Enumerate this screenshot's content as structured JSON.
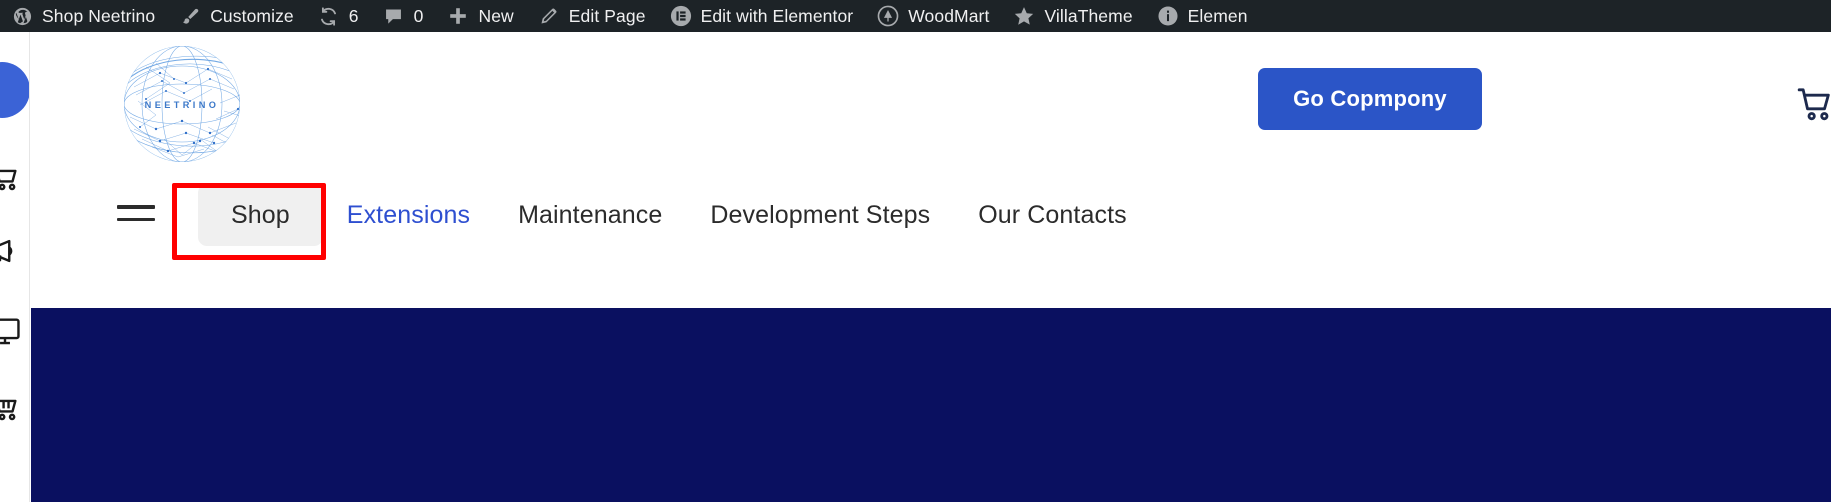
{
  "admin_bar": {
    "items": [
      {
        "label": "Shop Neetrino",
        "icon": "wordpress-dashboard-icon"
      },
      {
        "label": "Customize",
        "icon": "paintbrush-icon"
      },
      {
        "label": "6",
        "icon": "updates-refresh-icon"
      },
      {
        "label": "0",
        "icon": "comment-bubble-icon"
      },
      {
        "label": "New",
        "icon": "plus-icon"
      },
      {
        "label": "Edit Page",
        "icon": "pencil-edit-icon"
      },
      {
        "label": "Edit with Elementor",
        "icon": "elementor-icon"
      },
      {
        "label": "WoodMart",
        "icon": "woodmart-icon"
      },
      {
        "label": "VillaTheme",
        "icon": "star-icon"
      },
      {
        "label": "Elemen",
        "icon": "info-circle-icon"
      }
    ]
  },
  "rail": {
    "avatar_color": "#3b63d6",
    "icons": [
      {
        "name": "cart-outline-icon"
      },
      {
        "name": "megaphone-outline-icon"
      },
      {
        "name": "monitor-outline-icon"
      },
      {
        "name": "cart-dashed-outline-icon"
      }
    ]
  },
  "header": {
    "logo": {
      "name": "neetrino-globe-logo",
      "wordmark": "NEETRINO"
    },
    "cta_label": "Go Copmpony",
    "cta_color": "#2b55c7",
    "cart_icon": "shopping-cart-icon"
  },
  "nav": {
    "burger_icon": "hamburger-menu-icon",
    "items": [
      {
        "label": "Shop",
        "state": "active",
        "style": "pill"
      },
      {
        "label": "Extensions",
        "state": "default",
        "style": "blue"
      },
      {
        "label": "Maintenance",
        "state": "default",
        "style": "dark"
      },
      {
        "label": "Development Steps",
        "state": "default",
        "style": "dark"
      },
      {
        "label": "Our Contacts",
        "state": "default",
        "style": "dark"
      }
    ]
  },
  "annotation": {
    "target": "Shop",
    "color": "#ff0000"
  },
  "hero": {
    "background_color": "#0a1060"
  }
}
